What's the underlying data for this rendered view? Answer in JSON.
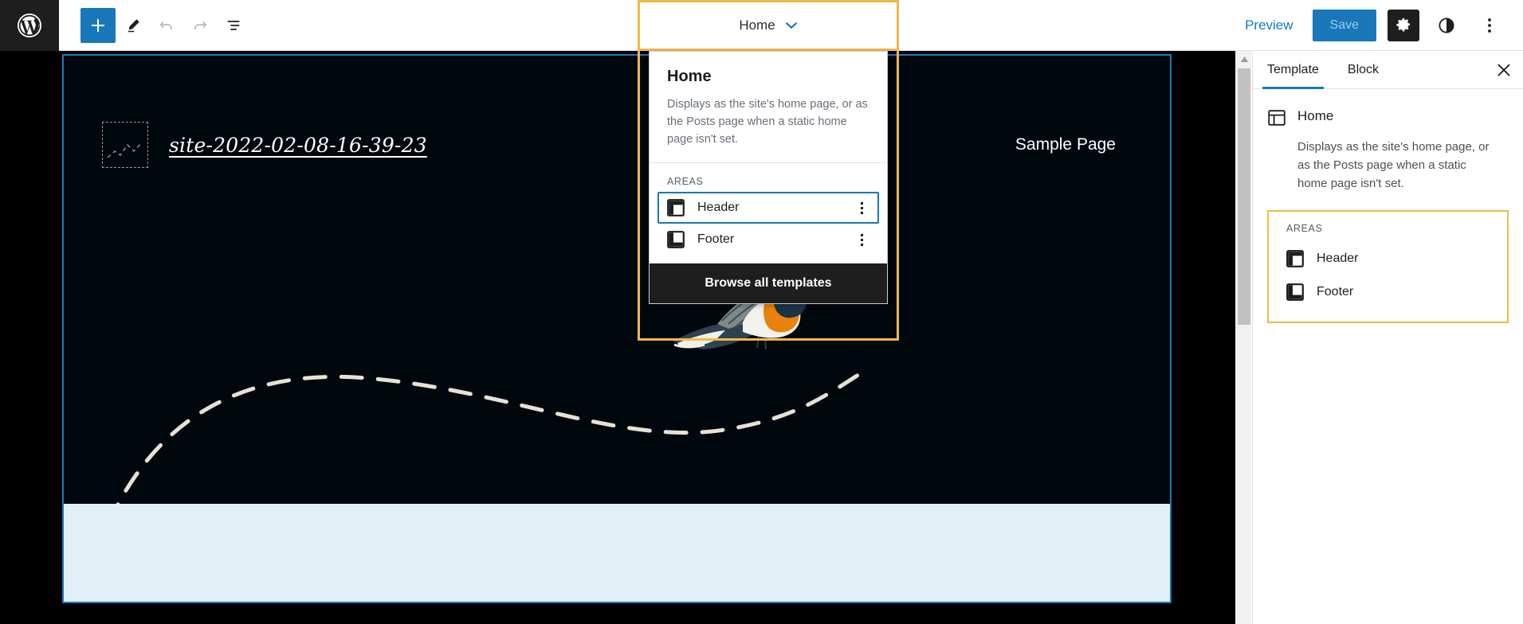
{
  "toolbar": {
    "logo_icon": "wordpress-logo-icon",
    "add_label": "+",
    "add_icon": "plus-icon",
    "edit_icon": "pencil-icon",
    "undo_icon": "undo-icon",
    "redo_icon": "redo-icon",
    "list_view_icon": "list-view-icon",
    "document_title": "Home",
    "chevron_icon": "chevron-down-icon",
    "preview_label": "Preview",
    "save_label": "Save",
    "settings_icon": "gear-icon",
    "styles_icon": "contrast-icon",
    "more_icon": "ellipsis-vertical-icon",
    "accent_blue": "#1878b9",
    "highlight_yellow": "#f0b849"
  },
  "dropdown": {
    "title": "Home",
    "description": "Displays as the site's home page, or as the Posts page when a static home page isn't set.",
    "areas_label": "AREAS",
    "areas": [
      {
        "label": "Header",
        "icon": "header-layout-icon",
        "selected": true
      },
      {
        "label": "Footer",
        "icon": "footer-layout-icon",
        "selected": false
      }
    ],
    "browse_label": "Browse all templates"
  },
  "canvas": {
    "site_title": "site-2022-02-08-16-39-23",
    "image_placeholder_icon": "image-placeholder-icon",
    "nav_link": "Sample Page",
    "bird_image": "flying-bird-illustration",
    "background_color": "#00070d",
    "body_color": "#e3eff7",
    "selection_color": "#1878b9"
  },
  "sidebar": {
    "tabs": [
      {
        "label": "Template",
        "active": true
      },
      {
        "label": "Block",
        "active": false
      }
    ],
    "close_icon": "close-icon",
    "template_icon": "template-layout-icon",
    "template_name": "Home",
    "template_description": "Displays as the site's home page, or as the Posts page when a static home page isn't set.",
    "areas_label": "AREAS",
    "areas": [
      {
        "label": "Header",
        "icon": "header-layout-icon"
      },
      {
        "label": "Footer",
        "icon": "footer-layout-icon"
      }
    ]
  },
  "scrollbar": {
    "up_arrow_icon": "scroll-up-arrow-icon"
  }
}
